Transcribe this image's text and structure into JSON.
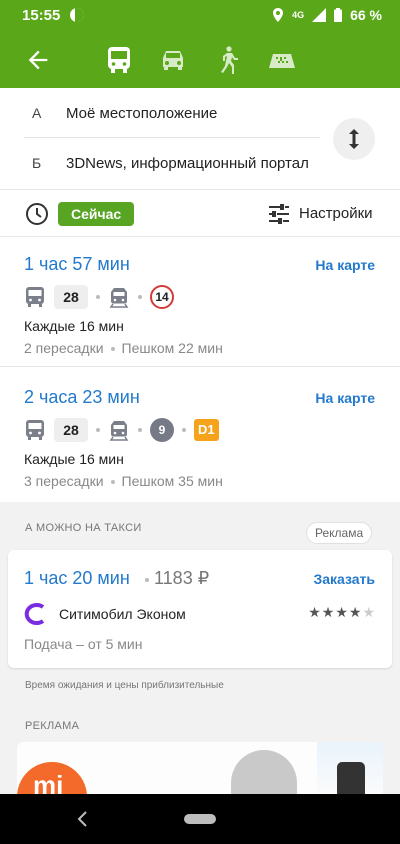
{
  "status_bar": {
    "time": "15:55",
    "network": "4G",
    "battery": "66 %"
  },
  "toolbar": {
    "modes": [
      "public-transport",
      "car",
      "walking",
      "taxi"
    ],
    "active_mode": "public-transport"
  },
  "route": {
    "from_letter": "А",
    "from_place": "Моё местоположение",
    "to_letter": "Б",
    "to_place": "3DNews, информационный портал"
  },
  "options": {
    "time_pill": "Сейчас",
    "settings_label": "Настройки"
  },
  "routes": [
    {
      "duration": "1 час 57 мин",
      "map_link": "На карте",
      "bus_number": "28",
      "tram_number": "14",
      "frequency": "Каждые 16 мин",
      "transfers": "2 пересадки",
      "walk": "Пешком 22 мин"
    },
    {
      "duration": "2 часа 23 мин",
      "map_link": "На карте",
      "bus_number": "28",
      "metro_number": "9",
      "d_line": "D1",
      "frequency": "Каждые 16 мин",
      "transfers": "3 пересадки",
      "walk": "Пешком 35 мин"
    }
  ],
  "taxi": {
    "heading": "А МОЖНО НА ТАКСИ",
    "ad_badge": "Реклама",
    "duration": "1 час 20 мин",
    "price": "1183 ₽",
    "order_label": "Заказать",
    "service": "Ситимобил Эконом",
    "rating": 4,
    "rating_max": 5,
    "pickup": "Подача – от 5 мин",
    "disclaimer": "Время ожидания и цены приблизительные"
  },
  "ad": {
    "heading": "РЕКЛАМА",
    "logo_text": "mi"
  },
  "colors": {
    "brand_green": "#5aa819",
    "link_blue": "#2379cc",
    "tram_red": "#d53a3a",
    "d1_orange": "#f6a21b"
  }
}
